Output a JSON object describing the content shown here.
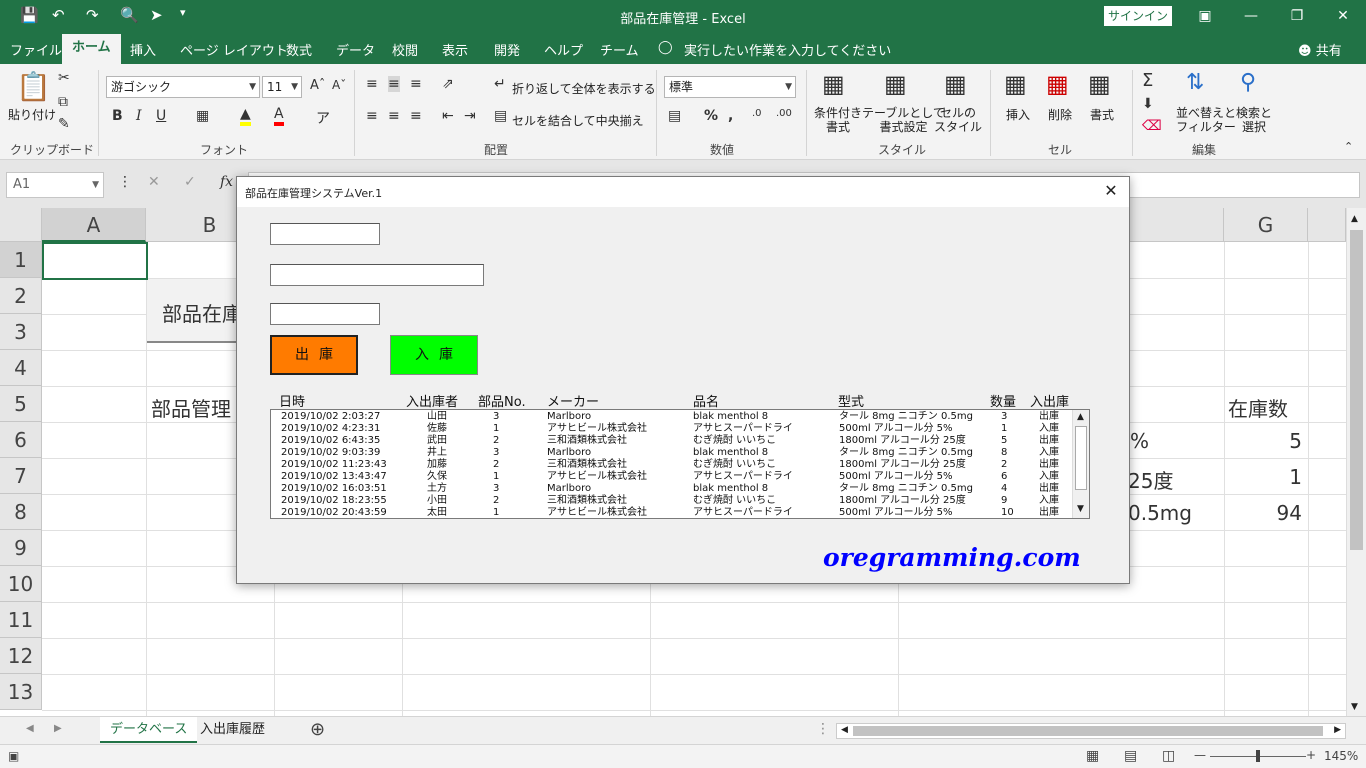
{
  "window": {
    "title": "部品在庫管理  -  Excel",
    "signin_label": "サインイン",
    "share_label": "共有"
  },
  "tabs": [
    "ファイル",
    "ホーム",
    "挿入",
    "ページ レイアウト",
    "数式",
    "データ",
    "校閲",
    "表示",
    "開発",
    "ヘルプ",
    "チーム"
  ],
  "tell_me": "実行したい作業を入力してください",
  "ribbon": {
    "groups": [
      "クリップボード",
      "フォント",
      "配置",
      "数値",
      "スタイル",
      "セル",
      "編集"
    ],
    "paste_label": "貼り付け",
    "font_name": "游ゴシック",
    "font_size": "11",
    "wrap_text": "折り返して全体を表示する",
    "merge_center": "セルを結合して中央揃え",
    "number_format": "標準",
    "conditional_format": "条件付き\n書式",
    "format_as_table": "テーブルとして\n書式設定",
    "cell_styles": "セルの\nスタイル",
    "insert": "挿入",
    "delete": "削除",
    "format": "書式",
    "sort_filter": "並べ替えと\nフィルター",
    "find_select": "検索と\n選択"
  },
  "formula_bar": {
    "name_box": "A1",
    "fx": "fx"
  },
  "sheet": {
    "columns": [
      "A",
      "B",
      "G"
    ],
    "rows": [
      "1",
      "2",
      "3",
      "4",
      "5",
      "6",
      "7",
      "8",
      "9",
      "10",
      "11",
      "12",
      "13"
    ],
    "cells": {
      "b2": "部品在庫",
      "b5": "部品管理",
      "g5": "在庫数",
      "f6": "%",
      "g6": "5",
      "f7": "25度",
      "g7": "1",
      "f8": "0.5mg",
      "g8": "94"
    }
  },
  "sheet_tabs": [
    "データベース",
    "入出庫履歴"
  ],
  "status": {
    "zoom": "145%"
  },
  "dialog": {
    "title": "部品在庫管理システムVer.1",
    "btn_out": "出庫",
    "btn_in": "入庫",
    "headers": [
      "日時",
      "入出庫者",
      "部品No.",
      "メーカー",
      "品名",
      "型式",
      "数量",
      "入出庫"
    ],
    "rows": [
      [
        "2019/10/02 2:03:27",
        "山田",
        "3",
        "Marlboro",
        "blak menthol 8",
        "タール 8mg  ニコチン 0.5mg",
        "3",
        "出庫"
      ],
      [
        "2019/10/02 4:23:31",
        "佐藤",
        "1",
        "アサヒビール株式会社",
        "アサヒスーパードライ",
        "500ml  アルコール分 5%",
        "1",
        "入庫"
      ],
      [
        "2019/10/02 6:43:35",
        "武田",
        "2",
        "三和酒類株式会社",
        "むぎ焼酎 いいちこ",
        "1800ml  アルコール分 25度",
        "5",
        "出庫"
      ],
      [
        "2019/10/02 9:03:39",
        "井上",
        "3",
        "Marlboro",
        "blak menthol 8",
        "タール 8mg  ニコチン 0.5mg",
        "8",
        "入庫"
      ],
      [
        "2019/10/02 11:23:43",
        "加藤",
        "2",
        "三和酒類株式会社",
        "むぎ焼酎 いいちこ",
        "1800ml  アルコール分 25度",
        "2",
        "出庫"
      ],
      [
        "2019/10/02 13:43:47",
        "久保",
        "1",
        "アサヒビール株式会社",
        "アサヒスーパードライ",
        "500ml  アルコール分 5%",
        "6",
        "入庫"
      ],
      [
        "2019/10/02 16:03:51",
        "土方",
        "3",
        "Marlboro",
        "blak menthol 8",
        "タール 8mg  ニコチン 0.5mg",
        "4",
        "出庫"
      ],
      [
        "2019/10/02 18:23:55",
        "小田",
        "2",
        "三和酒類株式会社",
        "むぎ焼酎 いいちこ",
        "1800ml  アルコール分 25度",
        "9",
        "入庫"
      ],
      [
        "2019/10/02 20:43:59",
        "太田",
        "1",
        "アサヒビール株式会社",
        "アサヒスーパードライ",
        "500ml  アルコール分 5%",
        "10",
        "出庫"
      ]
    ],
    "brand": "oregramming.com"
  },
  "colors": {
    "excel_green": "#217346",
    "btn_out": "#ff7b00",
    "btn_in": "#00ff00",
    "brand": "#0000ff"
  }
}
